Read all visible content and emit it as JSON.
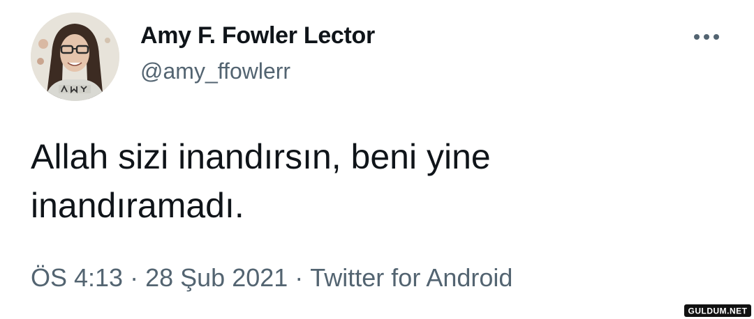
{
  "tweet": {
    "author": {
      "display_name": "Amy F. Fowler Lector",
      "handle": "@amy_ffowlerr",
      "avatar_icon": "profile-photo"
    },
    "more_icon": "more-horizontal-icon",
    "text_line1": "Allah sizi inandırsın, beni yine",
    "text_line2": "inandıramadı.",
    "time": "ÖS 4:13",
    "separator": "·",
    "date": "28 Şub 2021",
    "source": "Twitter for Android"
  },
  "watermark": {
    "text": "GULDUM.NET"
  },
  "colors": {
    "text_primary": "#0f1419",
    "text_secondary": "#536471",
    "background": "#ffffff"
  }
}
